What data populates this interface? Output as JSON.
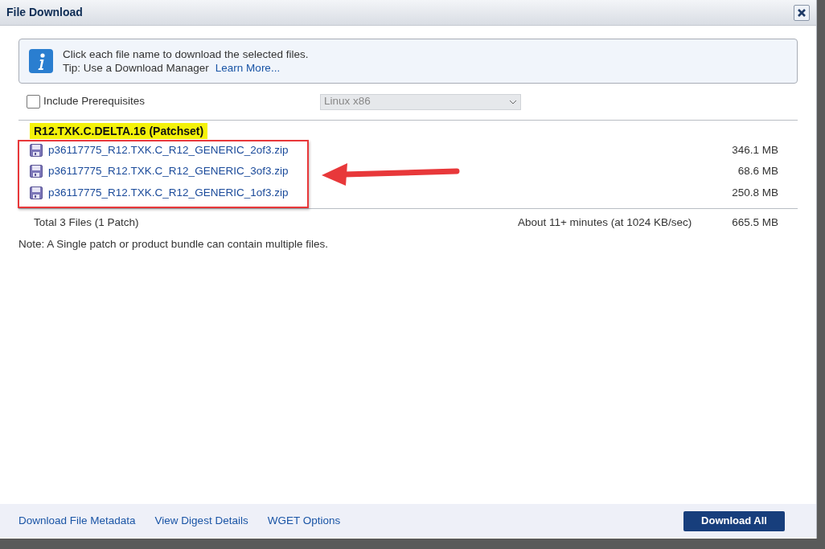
{
  "window": {
    "title": "File Download"
  },
  "info": {
    "message": "Click each file name to download the selected files.",
    "tip": "Tip: Use a Download Manager",
    "link": "Learn More..."
  },
  "include_prerequisites": {
    "label": "Include Prerequisites",
    "checked": false
  },
  "platform": {
    "value": "Linux x86",
    "disabled": true
  },
  "patch": {
    "title": "R12.TXK.C.DELTA.16 (Patchset)",
    "highlighted": true
  },
  "files": [
    {
      "name": "p36117775_R12.TXK.C_R12_GENERIC_2of3.zip",
      "size": "346.1 MB"
    },
    {
      "name": "p36117775_R12.TXK.C_R12_GENERIC_3of3.zip",
      "size": "68.6 MB"
    },
    {
      "name": "p36117775_R12.TXK.C_R12_GENERIC_1of3.zip",
      "size": "250.8 MB"
    }
  ],
  "total": {
    "label": "Total 3 Files (1 Patch)",
    "estimate": "About 11+ minutes (at 1024 KB/sec)",
    "size": "665.5 MB"
  },
  "note": "Note: A Single patch or product bundle can contain multiple files.",
  "footer": {
    "links": [
      "Download File Metadata",
      "View Digest Details",
      "WGET Options"
    ],
    "button": "Download All"
  }
}
